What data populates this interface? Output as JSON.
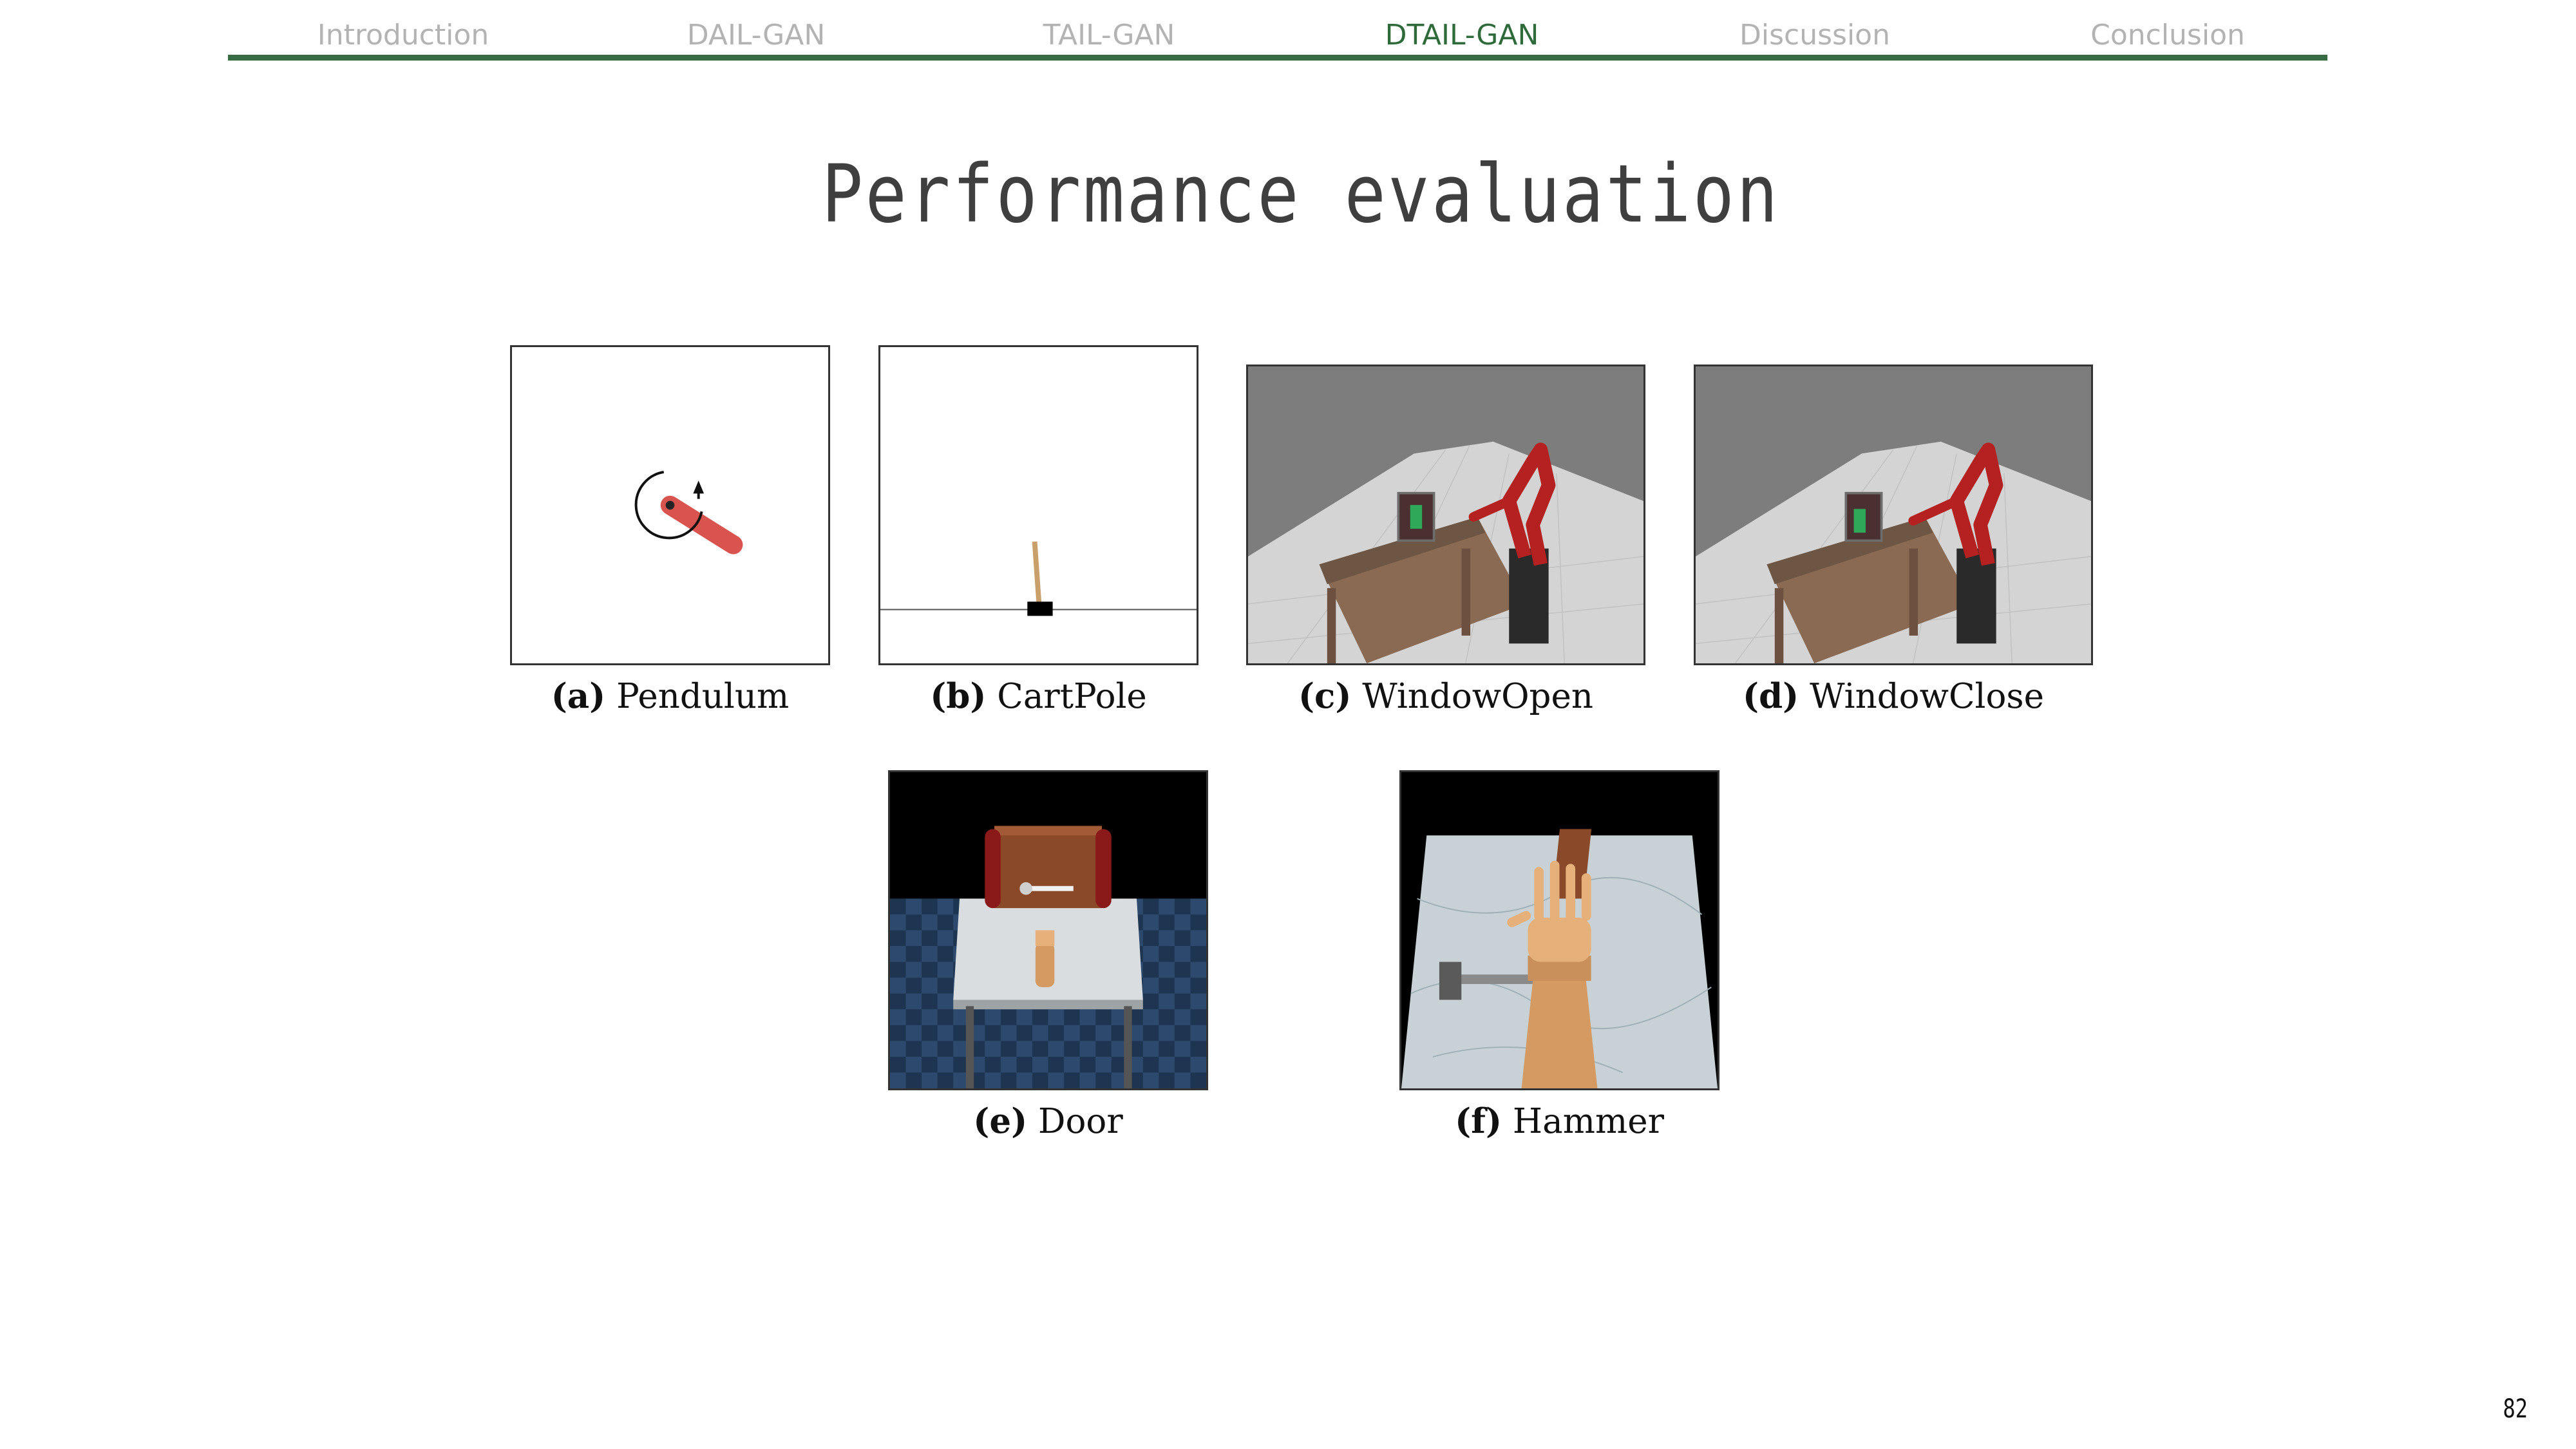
{
  "nav": {
    "items": [
      {
        "label": "Introduction",
        "active": false
      },
      {
        "label": "DAIL-GAN",
        "active": false
      },
      {
        "label": "TAIL-GAN",
        "active": false
      },
      {
        "label": "DTAIL-GAN",
        "active": true
      },
      {
        "label": "Discussion",
        "active": false
      },
      {
        "label": "Conclusion",
        "active": false
      }
    ],
    "active_color": "#2f6b3a",
    "inactive_color": "#b3b3b3",
    "rule_color": "#376b44"
  },
  "title": "Performance evaluation",
  "figures": [
    {
      "tag": "(a)",
      "name": "Pendulum",
      "icon": "pendulum-render"
    },
    {
      "tag": "(b)",
      "name": "CartPole",
      "icon": "cartpole-render"
    },
    {
      "tag": "(c)",
      "name": "WindowOpen",
      "icon": "robot-arm-window-render"
    },
    {
      "tag": "(d)",
      "name": "WindowClose",
      "icon": "robot-arm-window-render"
    },
    {
      "tag": "(e)",
      "name": "Door",
      "icon": "robot-hand-door-render"
    },
    {
      "tag": "(f)",
      "name": "Hammer",
      "icon": "robot-hand-hammer-render"
    }
  ],
  "page_number": "82"
}
